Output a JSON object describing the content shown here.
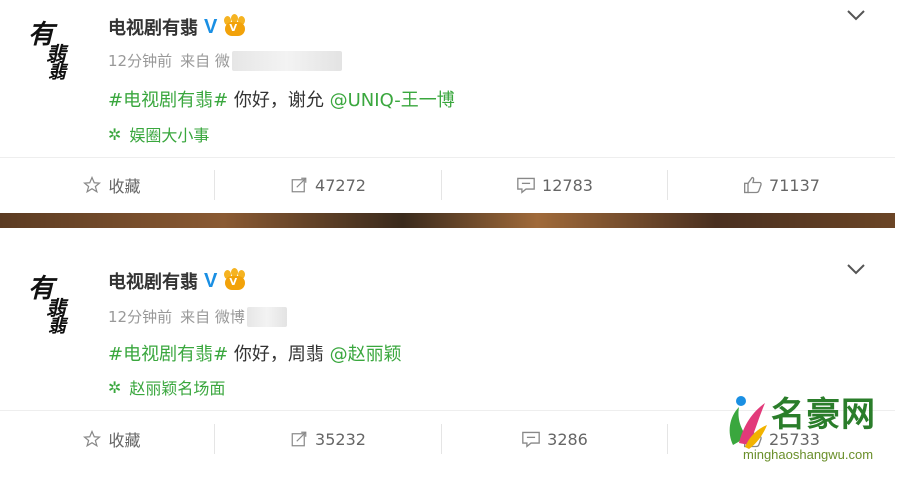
{
  "posts": [
    {
      "account_name": "电视剧有翡",
      "avatar_chars": [
        "有",
        "翡",
        "翡"
      ],
      "time": "12分钟前",
      "source_prefix": "来自 微",
      "hashtag": "#电视剧有翡#",
      "body": " 你好，谢允 ",
      "mention": "@UNIQ-王一博",
      "topic": "娱圈大小事",
      "actions": {
        "favorite": "收藏",
        "repost": "47272",
        "comment": "12783",
        "like": "71137"
      }
    },
    {
      "account_name": "电视剧有翡",
      "avatar_chars": [
        "有",
        "翡",
        "翡"
      ],
      "time": "12分钟前",
      "source_prefix": "来自 微博",
      "hashtag": "#电视剧有翡#",
      "body": " 你好，周翡 ",
      "mention": "@赵丽颖",
      "topic": "赵丽颖名场面",
      "actions": {
        "favorite": "收藏",
        "repost": "35232",
        "comment": "3286",
        "like": "25733"
      }
    }
  ],
  "watermark": {
    "brand": "名豪网",
    "url": "minghaoshangwu.com"
  },
  "colors": {
    "accent_green": "#3aa73e",
    "verified_blue": "#1a8fe3",
    "meta_gray": "#999999"
  }
}
